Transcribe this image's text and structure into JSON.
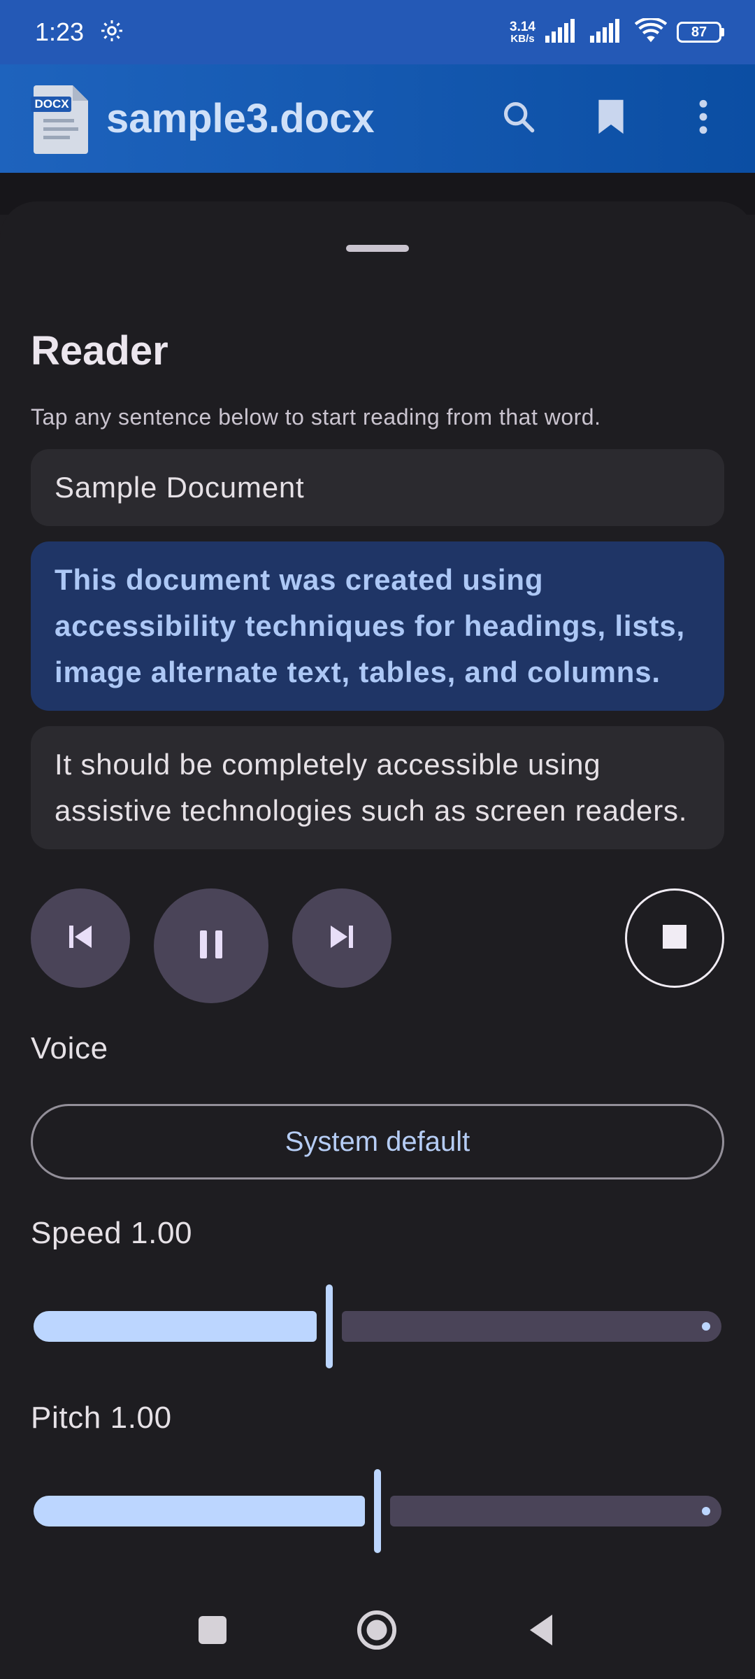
{
  "status_bar": {
    "time": "1:23",
    "net_speed_value": "3.14",
    "net_speed_unit": "KB/s",
    "battery": "87"
  },
  "app_bar": {
    "file_icon_label": "DOCX",
    "title": "sample3.docx",
    "actions": [
      "search-icon",
      "bookmark-icon",
      "more-vert-icon"
    ]
  },
  "reader": {
    "title": "Reader",
    "subtitle": "Tap any sentence below to start reading from that word.",
    "sentences": [
      "Sample Document",
      "This document was created using accessibility techniques for headings, lists, image alternate text, tables, and columns.",
      "It should be completely accessible using assistive technologies such as screen readers."
    ],
    "active_sentence_index": 1
  },
  "playback": {
    "buttons": [
      "skip-previous-icon",
      "pause-icon",
      "skip-next-icon",
      "stop-icon"
    ]
  },
  "voice": {
    "label": "Voice",
    "selected": "System default"
  },
  "speed": {
    "label": "Speed 1.00",
    "value": 1.0,
    "fraction": 0.43
  },
  "pitch": {
    "label": "Pitch 1.00",
    "value": 1.0,
    "fraction": 0.5
  },
  "colors": {
    "status_bar": "#2459b6",
    "app_bar": "#1e63bd",
    "sheet_bg": "#1e1d21",
    "active_sentence_bg": "#1f3566",
    "active_sentence_text": "#adc8f6",
    "slider_active": "#bcd6ff",
    "slider_inactive": "#4a4458"
  },
  "nav_bar": [
    "recents-icon",
    "home-icon",
    "back-icon"
  ]
}
